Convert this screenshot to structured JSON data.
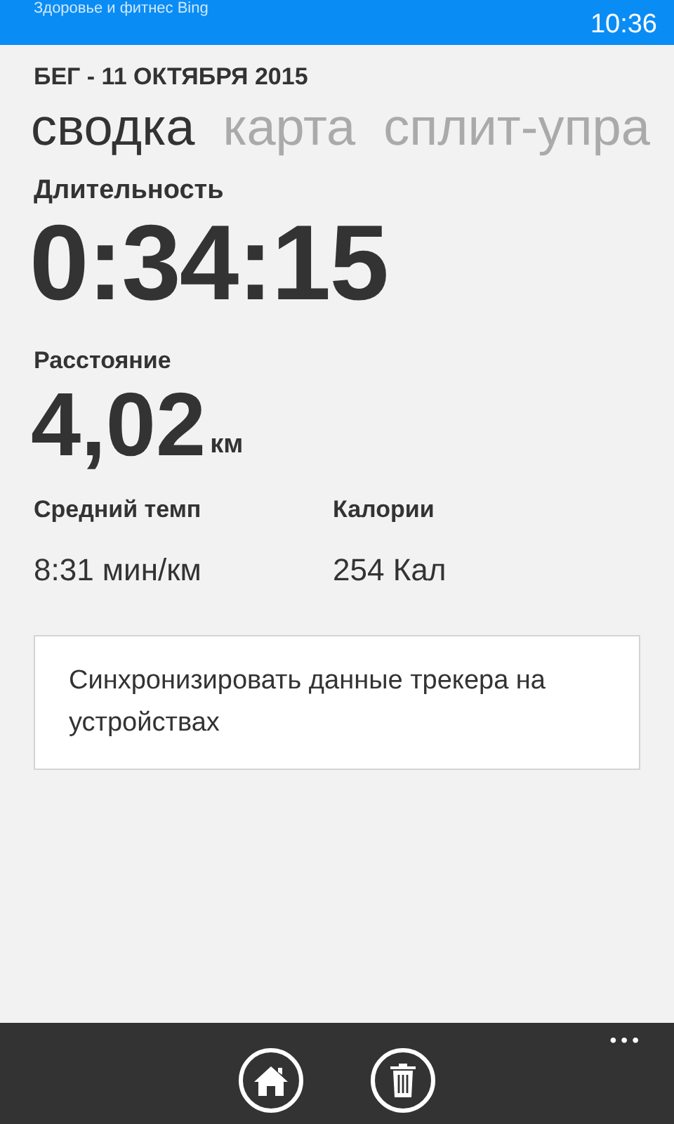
{
  "status_bar": {
    "app_title": "Здоровье и фитнес Bing",
    "time": "10:36"
  },
  "header": "БЕГ - 11 ОКТЯБРЯ 2015",
  "tabs": [
    {
      "label": "сводка",
      "selected": true
    },
    {
      "label": "карта",
      "selected": false
    },
    {
      "label": "сплит-упра",
      "selected": false
    }
  ],
  "duration": {
    "label": "Длительность",
    "value": "0:34:15"
  },
  "distance": {
    "label": "Расстояние",
    "value": "4,02",
    "unit": "км"
  },
  "stats": [
    {
      "label": "Средний темп",
      "value": "8:31 мин/км"
    },
    {
      "label": "Калории",
      "value": "254 Кал"
    }
  ],
  "sync_button": "Синхронизировать данные трекера на устройствах",
  "app_bar": {
    "buttons": [
      {
        "kind": "home"
      },
      {
        "kind": "delete"
      }
    ],
    "more": "•••"
  }
}
